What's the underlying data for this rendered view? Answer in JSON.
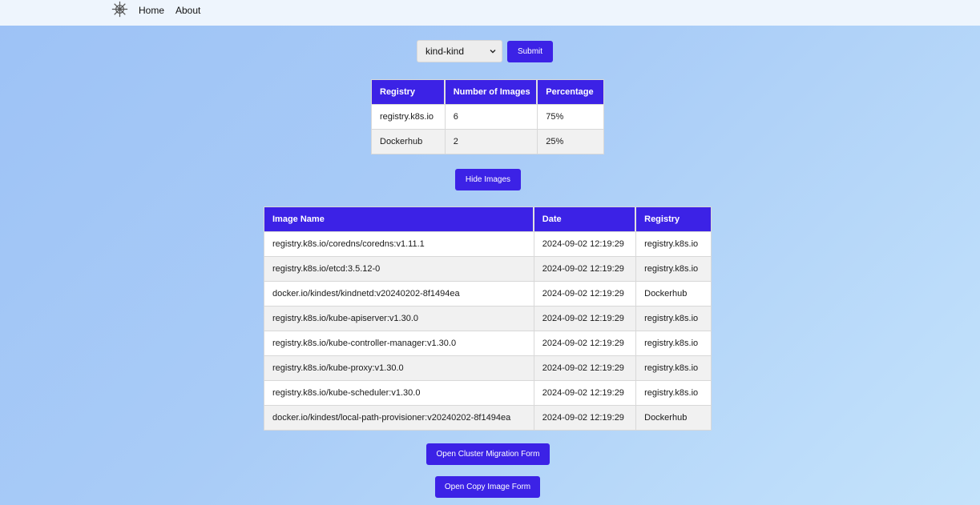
{
  "nav": {
    "logo_icon": "helm-wheel-icon",
    "links": [
      "Home",
      "About"
    ]
  },
  "form": {
    "cluster_selected": "kind-kind",
    "submit_label": "Submit"
  },
  "summary": {
    "headers": [
      "Registry",
      "Number of Images",
      "Percentage"
    ],
    "rows": [
      [
        "registry.k8s.io",
        "6",
        "75%"
      ],
      [
        "Dockerhub",
        "2",
        "25%"
      ]
    ]
  },
  "toggle_label": "Hide Images",
  "images": {
    "headers": [
      "Image Name",
      "Date",
      "Registry"
    ],
    "rows": [
      [
        "registry.k8s.io/coredns/coredns:v1.11.1",
        "2024-09-02 12:19:29",
        "registry.k8s.io"
      ],
      [
        "registry.k8s.io/etcd:3.5.12-0",
        "2024-09-02 12:19:29",
        "registry.k8s.io"
      ],
      [
        "docker.io/kindest/kindnetd:v20240202-8f1494ea",
        "2024-09-02 12:19:29",
        "Dockerhub"
      ],
      [
        "registry.k8s.io/kube-apiserver:v1.30.0",
        "2024-09-02 12:19:29",
        "registry.k8s.io"
      ],
      [
        "registry.k8s.io/kube-controller-manager:v1.30.0",
        "2024-09-02 12:19:29",
        "registry.k8s.io"
      ],
      [
        "registry.k8s.io/kube-proxy:v1.30.0",
        "2024-09-02 12:19:29",
        "registry.k8s.io"
      ],
      [
        "registry.k8s.io/kube-scheduler:v1.30.0",
        "2024-09-02 12:19:29",
        "registry.k8s.io"
      ],
      [
        "docker.io/kindest/local-path-provisioner:v20240202-8f1494ea",
        "2024-09-02 12:19:29",
        "Dockerhub"
      ]
    ]
  },
  "actions": {
    "migration_label": "Open Cluster Migration Form",
    "copy_label": "Open Copy Image Form"
  },
  "colors": {
    "accent": "#3c22e6",
    "navbar_bg": "#eef5fd"
  }
}
